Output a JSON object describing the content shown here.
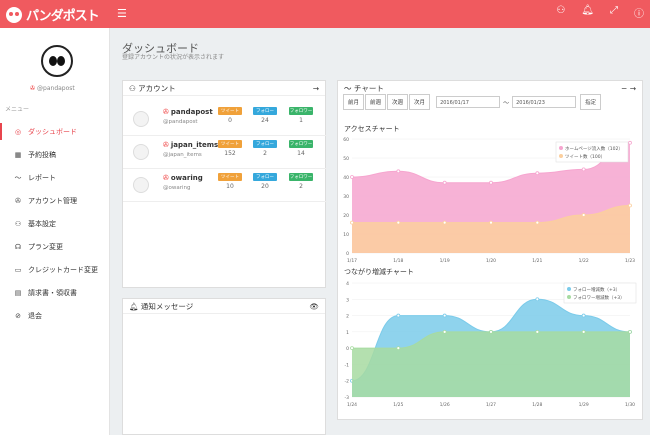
{
  "header": {
    "logo": "パンダポスト"
  },
  "sidebar": {
    "handle": "@pandapost",
    "menu_label": "メニュー",
    "items": [
      {
        "label": "ダッシュボード",
        "icon": "dashboard-icon",
        "glyph": "◎"
      },
      {
        "label": "予約投稿",
        "icon": "calendar-icon",
        "glyph": "▦"
      },
      {
        "label": "レポート",
        "icon": "chart-line-icon",
        "glyph": "〜"
      },
      {
        "label": "アカウント管理",
        "icon": "weibo-icon",
        "glyph": "✇"
      },
      {
        "label": "基本設定",
        "icon": "user-icon",
        "glyph": "⚇"
      },
      {
        "label": "プラン変更",
        "icon": "headset-icon",
        "glyph": "☊"
      },
      {
        "label": "クレジットカード変更",
        "icon": "credit-card-icon",
        "glyph": "▭"
      },
      {
        "label": "請求書・領収書",
        "icon": "document-icon",
        "glyph": "▤"
      },
      {
        "label": "退会",
        "icon": "ban-icon",
        "glyph": "⊘"
      }
    ]
  },
  "page": {
    "title": "ダッシュボード",
    "subtitle": "登録アカウントの状況が表示されます"
  },
  "accounts": {
    "title": "アカウント",
    "badge_tweet": "ツイート",
    "badge_follow": "フォロー",
    "badge_follower": "フォロワー",
    "rows": [
      {
        "name": "pandapost",
        "handle": "@pandapost",
        "tweets": "0",
        "follows": "24",
        "followers": "1"
      },
      {
        "name": "japan_items",
        "handle": "@japan_items",
        "tweets": "152",
        "follows": "2",
        "followers": "14"
      },
      {
        "name": "owaring",
        "handle": "@owaring",
        "tweets": "10",
        "follows": "20",
        "followers": "2"
      }
    ]
  },
  "notice": {
    "title": "通知メッセージ"
  },
  "charts": {
    "title": "チャート",
    "btn_prev_month": "前月",
    "btn_prev_week": "前週",
    "btn_next_week": "次週",
    "btn_next_month": "次月",
    "date_from": "2016/01/17",
    "date_to": "2016/01/23",
    "btn_apply": "指定"
  },
  "colors": {
    "brand": "#f05a5f",
    "pink": "#f6a5cf",
    "peach": "#fbcf9e",
    "blue": "#7bcbea",
    "green": "#a7dba1",
    "badge_orange": "#f0a13a",
    "badge_blue": "#35a8dc",
    "badge_green": "#3ab46a"
  },
  "chart_data": [
    {
      "type": "area",
      "title": "アクセスチャート",
      "categories": [
        "1/17",
        "1/18",
        "1/19",
        "1/20",
        "1/21",
        "1/22",
        "1/23"
      ],
      "ylim": [
        0,
        60
      ],
      "yticks": [
        "0",
        "10",
        "20",
        "30",
        "40",
        "50",
        "60"
      ],
      "series": [
        {
          "name": "ホームページ流入数（102）",
          "values": [
            40,
            43,
            37,
            37,
            42,
            44,
            58
          ]
        },
        {
          "name": "ツイート数（100）",
          "values": [
            16,
            16,
            16,
            16,
            16,
            20,
            25
          ]
        }
      ]
    },
    {
      "type": "area",
      "title": "つながり増減チャート",
      "categories": [
        "1/24",
        "1/25",
        "1/26",
        "1/27",
        "1/28",
        "1/29",
        "1/30"
      ],
      "ylim": [
        -3,
        4
      ],
      "yticks": [
        "-3",
        "-2",
        "-1",
        "0",
        "1",
        "2",
        "3",
        "4"
      ],
      "series": [
        {
          "name": "フォロー増減数（+3）",
          "values": [
            -2,
            2,
            2,
            1,
            3,
            2,
            1
          ]
        },
        {
          "name": "フォロワー増減数（+3）",
          "values": [
            0,
            0,
            1,
            1,
            1,
            1,
            1
          ]
        }
      ]
    }
  ]
}
